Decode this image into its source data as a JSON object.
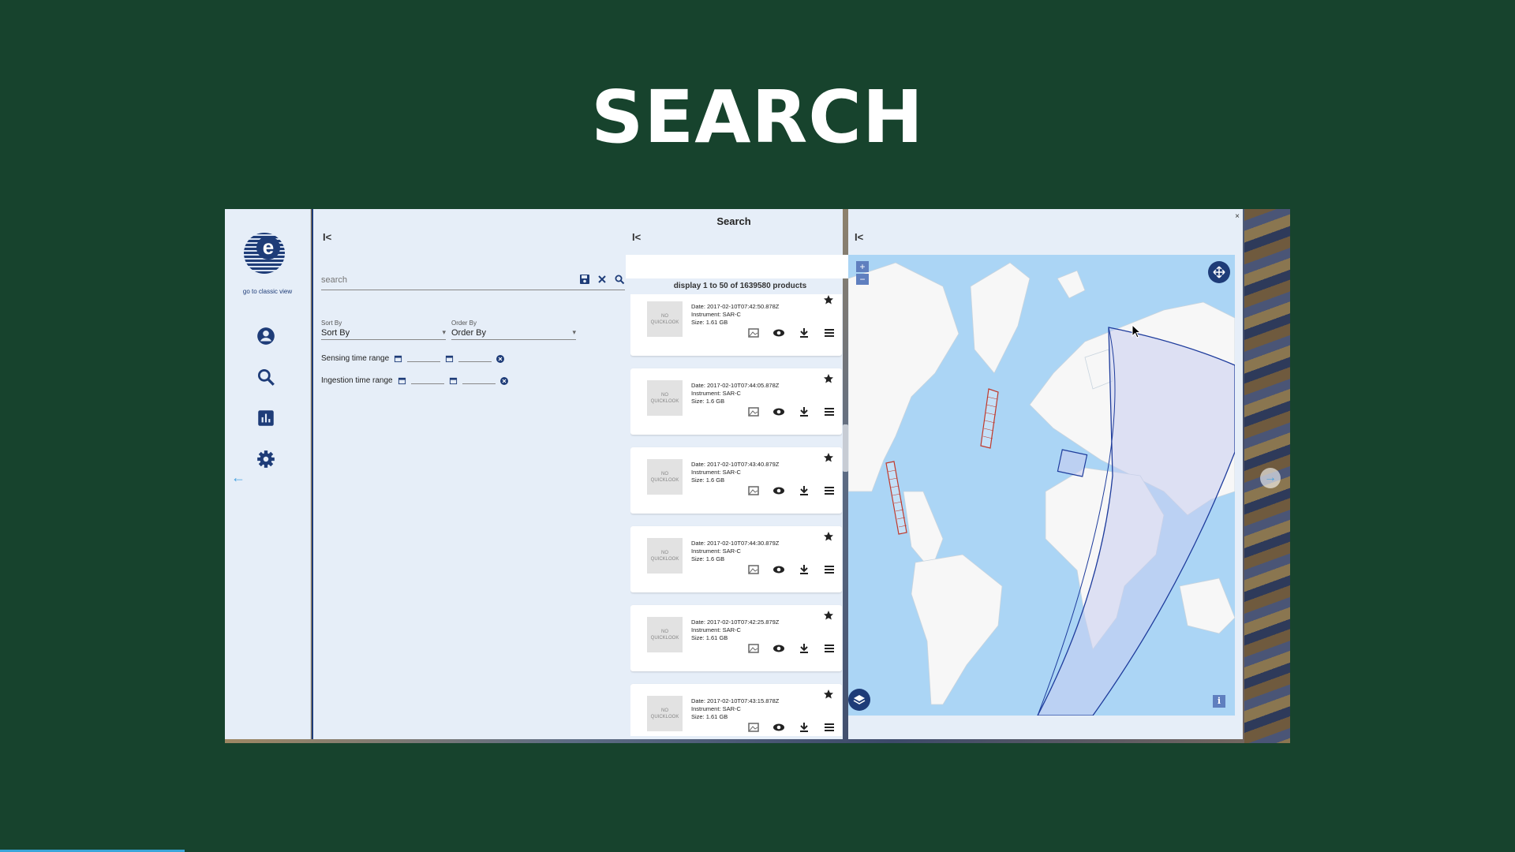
{
  "slide": {
    "title": "SEARCH",
    "progress_fraction": 0.122
  },
  "app": {
    "dialog_title": "Search",
    "close_label": "×",
    "classic_view_label": "go to classic view",
    "collapse_label": "I<",
    "nav": [
      "user-icon",
      "search-icon",
      "bar-chart-icon",
      "gear-icon"
    ],
    "accent_color": "#1e3c78"
  },
  "filters": {
    "search_placeholder": "search",
    "sort_by": {
      "label": "Sort By",
      "value": "Sort By"
    },
    "order_by": {
      "label": "Order By",
      "value": "Order By"
    },
    "sensing_range_label": "Sensing time range",
    "ingestion_range_label": "Ingestion time range"
  },
  "results": {
    "count_text": "display 1 to 50 of 1639580 products",
    "quicklook_text": "NO QUICKLOOK",
    "items": [
      {
        "date": "Date: 2017-02-10T07:42:50.878Z",
        "instrument": "Instrument: SAR-C",
        "size": "Size: 1.61 GB"
      },
      {
        "date": "Date: 2017-02-10T07:44:05.878Z",
        "instrument": "Instrument: SAR-C",
        "size": "Size: 1.6 GB"
      },
      {
        "date": "Date: 2017-02-10T07:43:40.879Z",
        "instrument": "Instrument: SAR-C",
        "size": "Size: 1.6 GB"
      },
      {
        "date": "Date: 2017-02-10T07:44:30.879Z",
        "instrument": "Instrument: SAR-C",
        "size": "Size: 1.6 GB"
      },
      {
        "date": "Date: 2017-02-10T07:42:25.879Z",
        "instrument": "Instrument: SAR-C",
        "size": "Size: 1.61 GB"
      },
      {
        "date": "Date: 2017-02-10T07:43:15.878Z",
        "instrument": "Instrument: SAR-C",
        "size": "Size: 1.61 GB"
      }
    ]
  },
  "map": {
    "zoom_in_label": "+",
    "zoom_out_label": "−",
    "info_label": "i",
    "ocean_color": "#abd5f5",
    "footprint_color": "#c0392b",
    "orbit_color": "#1e3c9c"
  }
}
